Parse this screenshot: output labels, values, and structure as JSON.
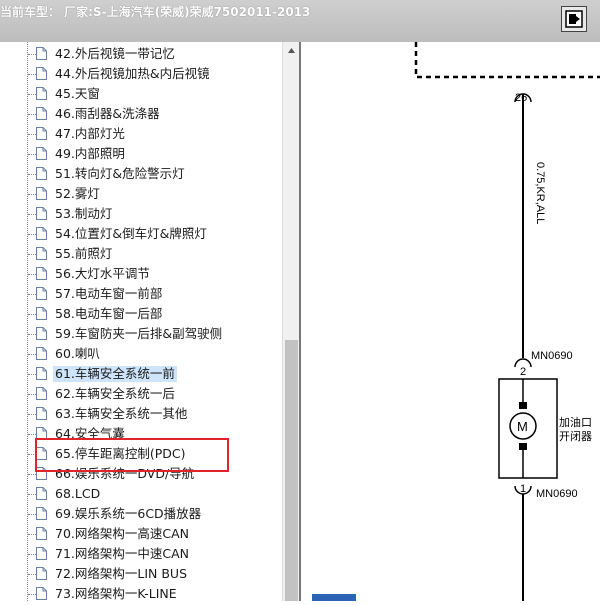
{
  "window": {
    "title": "当前车型： 厂家:S-上海汽车(荣威)荣威7502011-2013",
    "button_icon": "restore-window-icon"
  },
  "tree": {
    "items": [
      {
        "label": "42.外后视镜一带记忆"
      },
      {
        "label": "44.外后视镜加热&内后视镜"
      },
      {
        "label": "45.天窗"
      },
      {
        "label": "46.雨刮器&洗涤器"
      },
      {
        "label": "47.内部灯光"
      },
      {
        "label": "49.内部照明"
      },
      {
        "label": "51.转向灯&危险警示灯"
      },
      {
        "label": "52.雾灯"
      },
      {
        "label": "53.制动灯"
      },
      {
        "label": "54.位置灯&倒车灯&牌照灯"
      },
      {
        "label": "55.前照灯"
      },
      {
        "label": "56.大灯水平调节"
      },
      {
        "label": "57.电动车窗一前部"
      },
      {
        "label": "58.电动车窗一后部"
      },
      {
        "label": "59.车窗防夹一后排&副驾驶侧"
      },
      {
        "label": "60.喇叭"
      },
      {
        "label": "61.车辆安全系统一前",
        "selected": true
      },
      {
        "label": "62.车辆安全系统一后"
      },
      {
        "label": "63.车辆安全系统一其他"
      },
      {
        "label": "64.安全气囊"
      },
      {
        "label": "65.停车距离控制(PDC)"
      },
      {
        "label": "66.娱乐系统一DVD/导航"
      },
      {
        "label": "68.LCD"
      },
      {
        "label": "69.娱乐系统一6CD播放器"
      },
      {
        "label": "70.网络架构一高速CAN"
      },
      {
        "label": "71.网络架构一中速CAN"
      },
      {
        "label": "72.网络架构一LIN BUS"
      },
      {
        "label": "73.网络架构一K-LINE"
      }
    ]
  },
  "diagram": {
    "connector_top_pin": "26",
    "wire_label": "0.75,KR,ALL",
    "upper_connector": "MN0690",
    "upper_pin": "2",
    "motor_symbol": "M",
    "motor_label_line1": "加油口",
    "motor_label_line2": "开闭器",
    "lower_connector": "MN0690",
    "lower_pin": "1"
  }
}
